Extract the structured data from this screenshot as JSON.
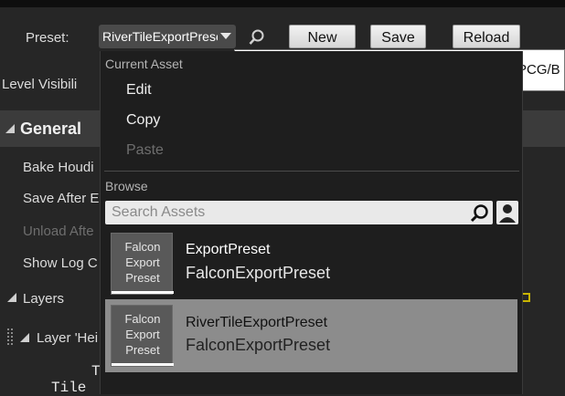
{
  "preset": {
    "label": "Preset:",
    "selected": "RiverTileExportPreset",
    "new_label": "New",
    "save_label": "Save",
    "reload_label": "Reload"
  },
  "path_value": "PCG/B",
  "panel": {
    "level_visibility": "Level Visibili",
    "general": "General",
    "bake_houdini": "Bake Houdi",
    "save_after": "Save After E",
    "unload_after": "Unload Afte",
    "show_log": "Show Log C",
    "layers": "Layers",
    "layer_hei": "Layer 'Hei",
    "mono_t": "T",
    "mono_tile": "Tile"
  },
  "dropdown": {
    "current_asset_header": "Current Asset",
    "edit": "Edit",
    "copy": "Copy",
    "paste": "Paste",
    "browse_header": "Browse",
    "search_placeholder": "Search Assets",
    "assets": [
      {
        "thumb_line1": "Falcon",
        "thumb_line2": "Export",
        "thumb_line3": "Preset",
        "name": "ExportPreset",
        "type": "FalconExportPreset"
      },
      {
        "thumb_line1": "Falcon",
        "thumb_line2": "Export",
        "thumb_line3": "Preset",
        "name": "RiverTileExportPreset",
        "type": "FalconExportPreset"
      }
    ]
  },
  "colors": {
    "background": "#262626",
    "selected_row": "#8c8c8c",
    "disabled_text": "#6e6e6e"
  }
}
